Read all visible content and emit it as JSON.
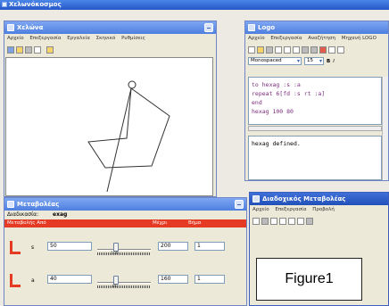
{
  "app": {
    "title": "Χελωνόκοσμος"
  },
  "turtle_window": {
    "title": "Χελώνα",
    "menu": [
      "Αρχείο",
      "Επεξεργασία",
      "Εργαλεία",
      "Σκηνικό",
      "Ρυθμίσεις"
    ]
  },
  "logo_window": {
    "title": "Logo",
    "menu": [
      "Αρχείο",
      "Επεξεργασία",
      "Αναζήτηση",
      "Μηχανή LOGO"
    ],
    "font": "Monospaced",
    "font_size": "15",
    "code_lines": [
      "to hexag :s :a",
      "repeat 6[fd :s rt :a]",
      "end",
      "hexag 100 80"
    ],
    "output": "hexag defined."
  },
  "variables_window": {
    "title": "Μεταβολέας",
    "procedure_label": "Διαδικασία:",
    "procedure_value": "exag",
    "col_from": "Μεταβολής Από",
    "col_to": "Μέχρι",
    "col_step": "Βήμα",
    "rows": [
      {
        "name": "s",
        "from": "50",
        "mid": "100",
        "to": "200",
        "step": "1",
        "level": 0.33
      },
      {
        "name": "a",
        "from": "40",
        "mid": "80",
        "to": "160",
        "step": "1",
        "level": 0.33
      }
    ]
  },
  "inspector_window": {
    "title": "Διαδοχικός Μεταβολέας",
    "menu": [
      "Αρχείο",
      "Επεξεργασία",
      "Προβολή"
    ]
  },
  "figure_label": "Figure1",
  "colors": {
    "accent_red": "#e53a24",
    "title_blue": "#4e7fe0"
  }
}
